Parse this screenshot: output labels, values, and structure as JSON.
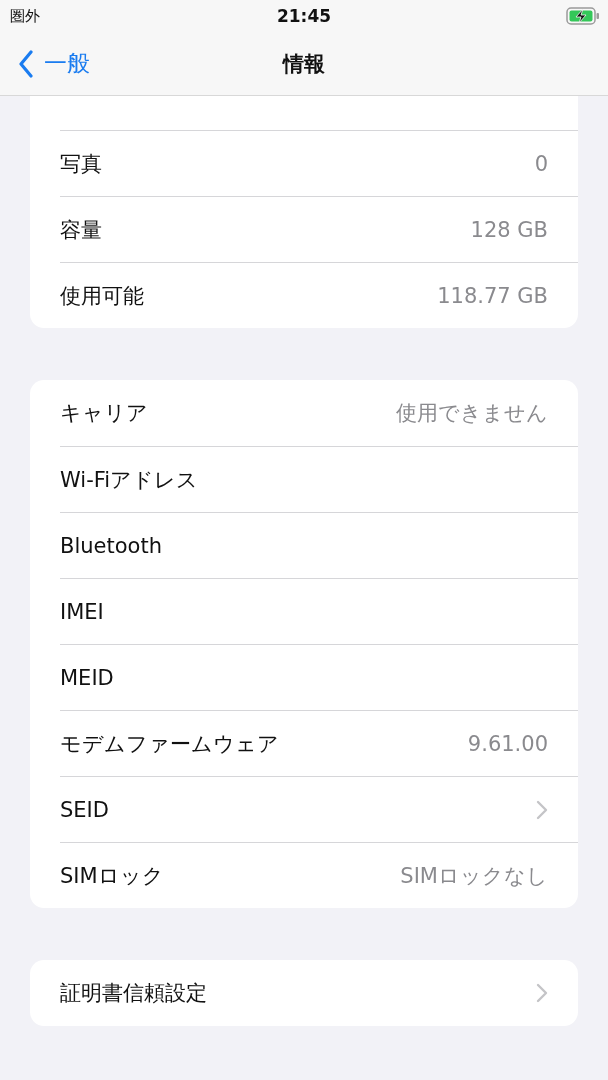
{
  "status_bar": {
    "carrier": "圏外",
    "time": "21:45",
    "battery": {
      "charging": true
    }
  },
  "nav": {
    "back": "一般",
    "title": "情報"
  },
  "groups": [
    {
      "rows": [
        {
          "label": "写真",
          "value": "0",
          "kind": "value"
        },
        {
          "label": "容量",
          "value": "128 GB",
          "kind": "value"
        },
        {
          "label": "使用可能",
          "value": "118.77 GB",
          "kind": "value"
        }
      ]
    },
    {
      "rows": [
        {
          "label": "キャリア",
          "value": "使用できません",
          "kind": "value"
        },
        {
          "label": "Wi-Fiアドレス",
          "kind": "value"
        },
        {
          "label": "Bluetooth",
          "kind": "value"
        },
        {
          "label": "IMEI",
          "kind": "value"
        },
        {
          "label": "MEID",
          "kind": "value"
        },
        {
          "label": "モデムファームウェア",
          "value": "9.61.00",
          "kind": "value"
        },
        {
          "label": "SEID",
          "kind": "link"
        },
        {
          "label": "SIMロック",
          "value": "SIMロックなし",
          "kind": "value"
        }
      ]
    },
    {
      "rows": [
        {
          "label": "証明書信頼設定",
          "kind": "link"
        }
      ]
    }
  ]
}
